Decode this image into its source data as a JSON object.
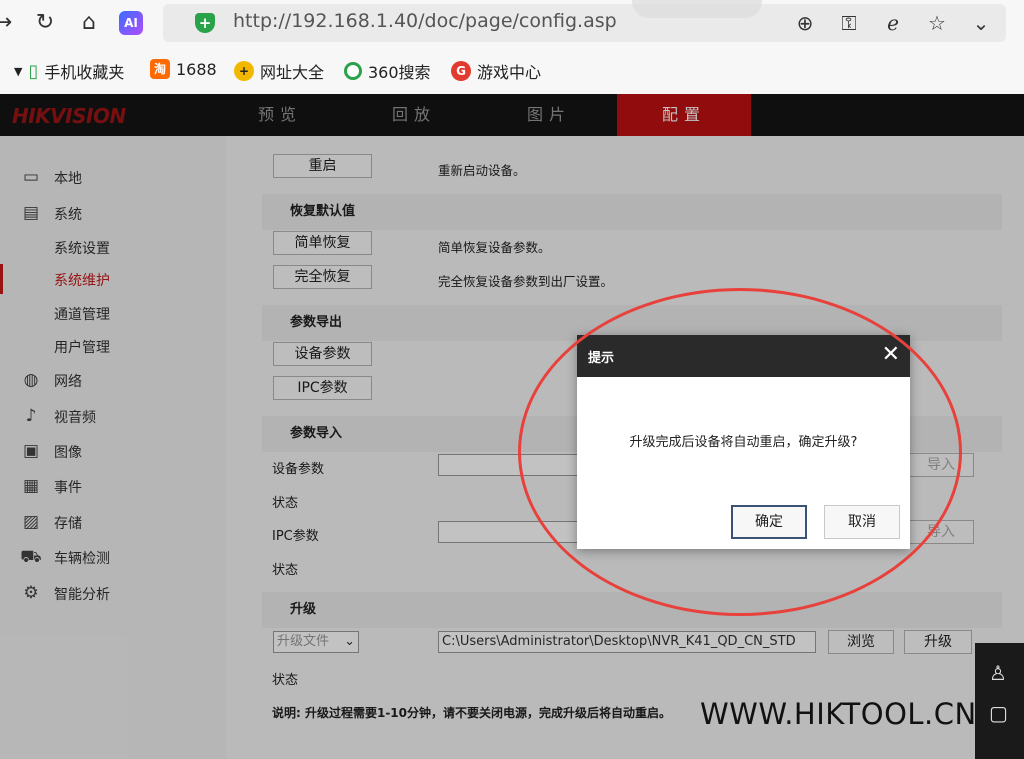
{
  "browser": {
    "url": "http://192.168.1.40/doc/page/config.asp",
    "ai_label": "AI",
    "bookmarks": [
      {
        "label": "手机收藏夹",
        "icon": "phone-icon",
        "color": "#2ba24a"
      },
      {
        "label": "1688",
        "icon": "alibaba-1688-icon",
        "color": "#ff6a00"
      },
      {
        "label": "网址大全",
        "icon": "plus-circle-icon",
        "color": "#f2b800"
      },
      {
        "label": "360搜索",
        "icon": "search-360-icon",
        "color": "#2aa24a"
      },
      {
        "label": "游戏中心",
        "icon": "game-icon",
        "color": "#e23a2e"
      }
    ]
  },
  "header": {
    "logo": "HIKVISION",
    "tabs": [
      {
        "label": "预览"
      },
      {
        "label": "回放"
      },
      {
        "label": "图片"
      },
      {
        "label": "配置",
        "active": true
      }
    ]
  },
  "sidebar": {
    "items": [
      {
        "label": "本地",
        "icon": "monitor-icon"
      },
      {
        "label": "系统",
        "icon": "system-icon"
      },
      {
        "label": "系统设置",
        "sub": true
      },
      {
        "label": "系统维护",
        "sub": true,
        "active": true
      },
      {
        "label": "通道管理",
        "sub": true
      },
      {
        "label": "用户管理",
        "sub": true
      },
      {
        "label": "网络",
        "icon": "globe-icon"
      },
      {
        "label": "视音频",
        "icon": "mic-icon"
      },
      {
        "label": "图像",
        "icon": "image-icon"
      },
      {
        "label": "事件",
        "icon": "calendar-icon"
      },
      {
        "label": "存储",
        "icon": "save-icon"
      },
      {
        "label": "车辆检测",
        "icon": "car-icon"
      },
      {
        "label": "智能分析",
        "icon": "analysis-icon"
      }
    ]
  },
  "main": {
    "reboot": {
      "button": "重启",
      "desc": "重新启动设备。"
    },
    "restore": {
      "title": "恢复默认值",
      "simple_btn": "简单恢复",
      "simple_desc": "简单恢复设备参数。",
      "full_btn": "完全恢复",
      "full_desc": "完全恢复设备参数到出厂设置。"
    },
    "export": {
      "title": "参数导出",
      "device_btn": "设备参数",
      "ipc_btn": "IPC参数"
    },
    "import": {
      "title": "参数导入",
      "device_label": "设备参数",
      "status_label": "状态",
      "ipc_label": "IPC参数",
      "status_label2": "状态",
      "import_btn": "导入",
      "import_btn2": "导入"
    },
    "upgrade": {
      "title": "升级",
      "select_value": "升级文件",
      "path": "C:\\Users\\Administrator\\Desktop\\NVR_K41_QD_CN_STD",
      "browse_btn": "浏览",
      "upgrade_btn": "升级",
      "status_label": "状态",
      "note": "说明: 升级过程需要1-10分钟，请不要关闭电源，完成升级后将自动重启。"
    }
  },
  "dialog": {
    "title": "提示",
    "message": "升级完成后设备将自动重启，确定升级?",
    "confirm": "确定",
    "cancel": "取消"
  },
  "watermark": "WWW.HIKTOOL.CN",
  "colors": {
    "accent": "#bf1111",
    "ellipse": "#e8413c",
    "header_bg": "#141414"
  }
}
